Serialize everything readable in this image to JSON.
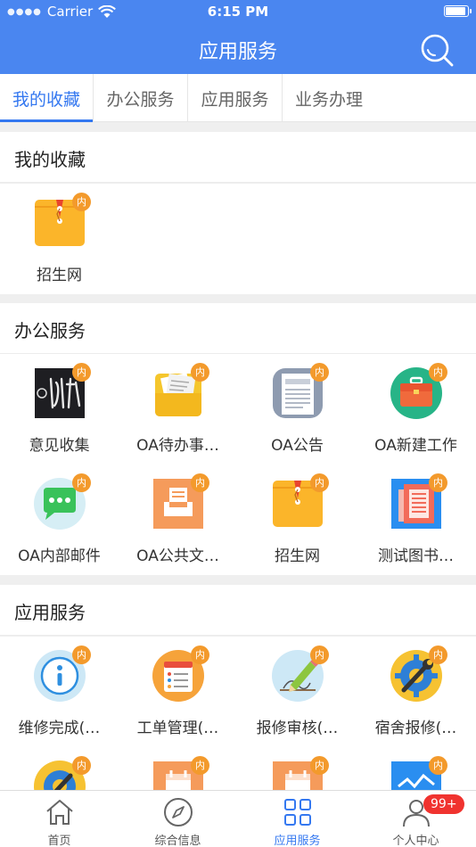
{
  "status_bar": {
    "carrier": "Carrier",
    "time": "6:15 PM"
  },
  "navbar": {
    "title": "应用服务",
    "search_icon": "search-icon"
  },
  "tabs": [
    {
      "label": "我的收藏",
      "active": true
    },
    {
      "label": "办公服务",
      "active": false
    },
    {
      "label": "应用服务",
      "active": false
    },
    {
      "label": "业务办理",
      "active": false
    }
  ],
  "favorites": {
    "title": "我的收藏",
    "items": [
      {
        "label": "招生网",
        "badge": "内",
        "icon": "envelope-folder-icon"
      }
    ]
  },
  "office": {
    "title": "办公服务",
    "items": [
      {
        "label": "意见收集",
        "badge": "内",
        "icon": "calligraphy-logo-icon"
      },
      {
        "label": "OA待办事…",
        "badge": "内",
        "icon": "folder-documents-icon"
      },
      {
        "label": "OA公告",
        "badge": "内",
        "icon": "newspaper-icon"
      },
      {
        "label": "OA新建工作",
        "badge": "内",
        "icon": "briefcase-icon"
      },
      {
        "label": "OA内部邮件",
        "badge": "内",
        "icon": "chat-bubble-icon"
      },
      {
        "label": "OA公共文…",
        "badge": "内",
        "icon": "inbox-tray-icon"
      },
      {
        "label": "招生网",
        "badge": "内",
        "icon": "envelope-folder-icon"
      },
      {
        "label": "测试图书…",
        "badge": "内",
        "icon": "newspaper-fold-icon"
      }
    ]
  },
  "apps": {
    "title": "应用服务",
    "items": [
      {
        "label": "维修完成(…",
        "badge": "内",
        "icon": "info-circle-icon"
      },
      {
        "label": "工单管理(…",
        "badge": "内",
        "icon": "checklist-icon"
      },
      {
        "label": "报修审核(…",
        "badge": "内",
        "icon": "pencil-sign-icon"
      },
      {
        "label": "宿舍报修(…",
        "badge": "内",
        "icon": "gear-wrench-icon"
      },
      {
        "label": "",
        "badge": "内",
        "icon": "gear-wrench-icon"
      },
      {
        "label": "",
        "badge": "内",
        "icon": "calendar-icon"
      },
      {
        "label": "",
        "badge": "内",
        "icon": "calendar-icon"
      },
      {
        "label": "",
        "badge": "内",
        "icon": "chart-image-icon"
      }
    ]
  },
  "tabbar": [
    {
      "label": "首页",
      "icon": "home-icon",
      "active": false
    },
    {
      "label": "综合信息",
      "icon": "compass-icon",
      "active": false
    },
    {
      "label": "应用服务",
      "icon": "grid-icon",
      "active": true
    },
    {
      "label": "个人中心",
      "icon": "person-icon",
      "active": false,
      "count": "99+"
    }
  ],
  "colors": {
    "primary": "#4a86f0",
    "badge": "#f39a2c",
    "count_badge": "#f0332f"
  }
}
